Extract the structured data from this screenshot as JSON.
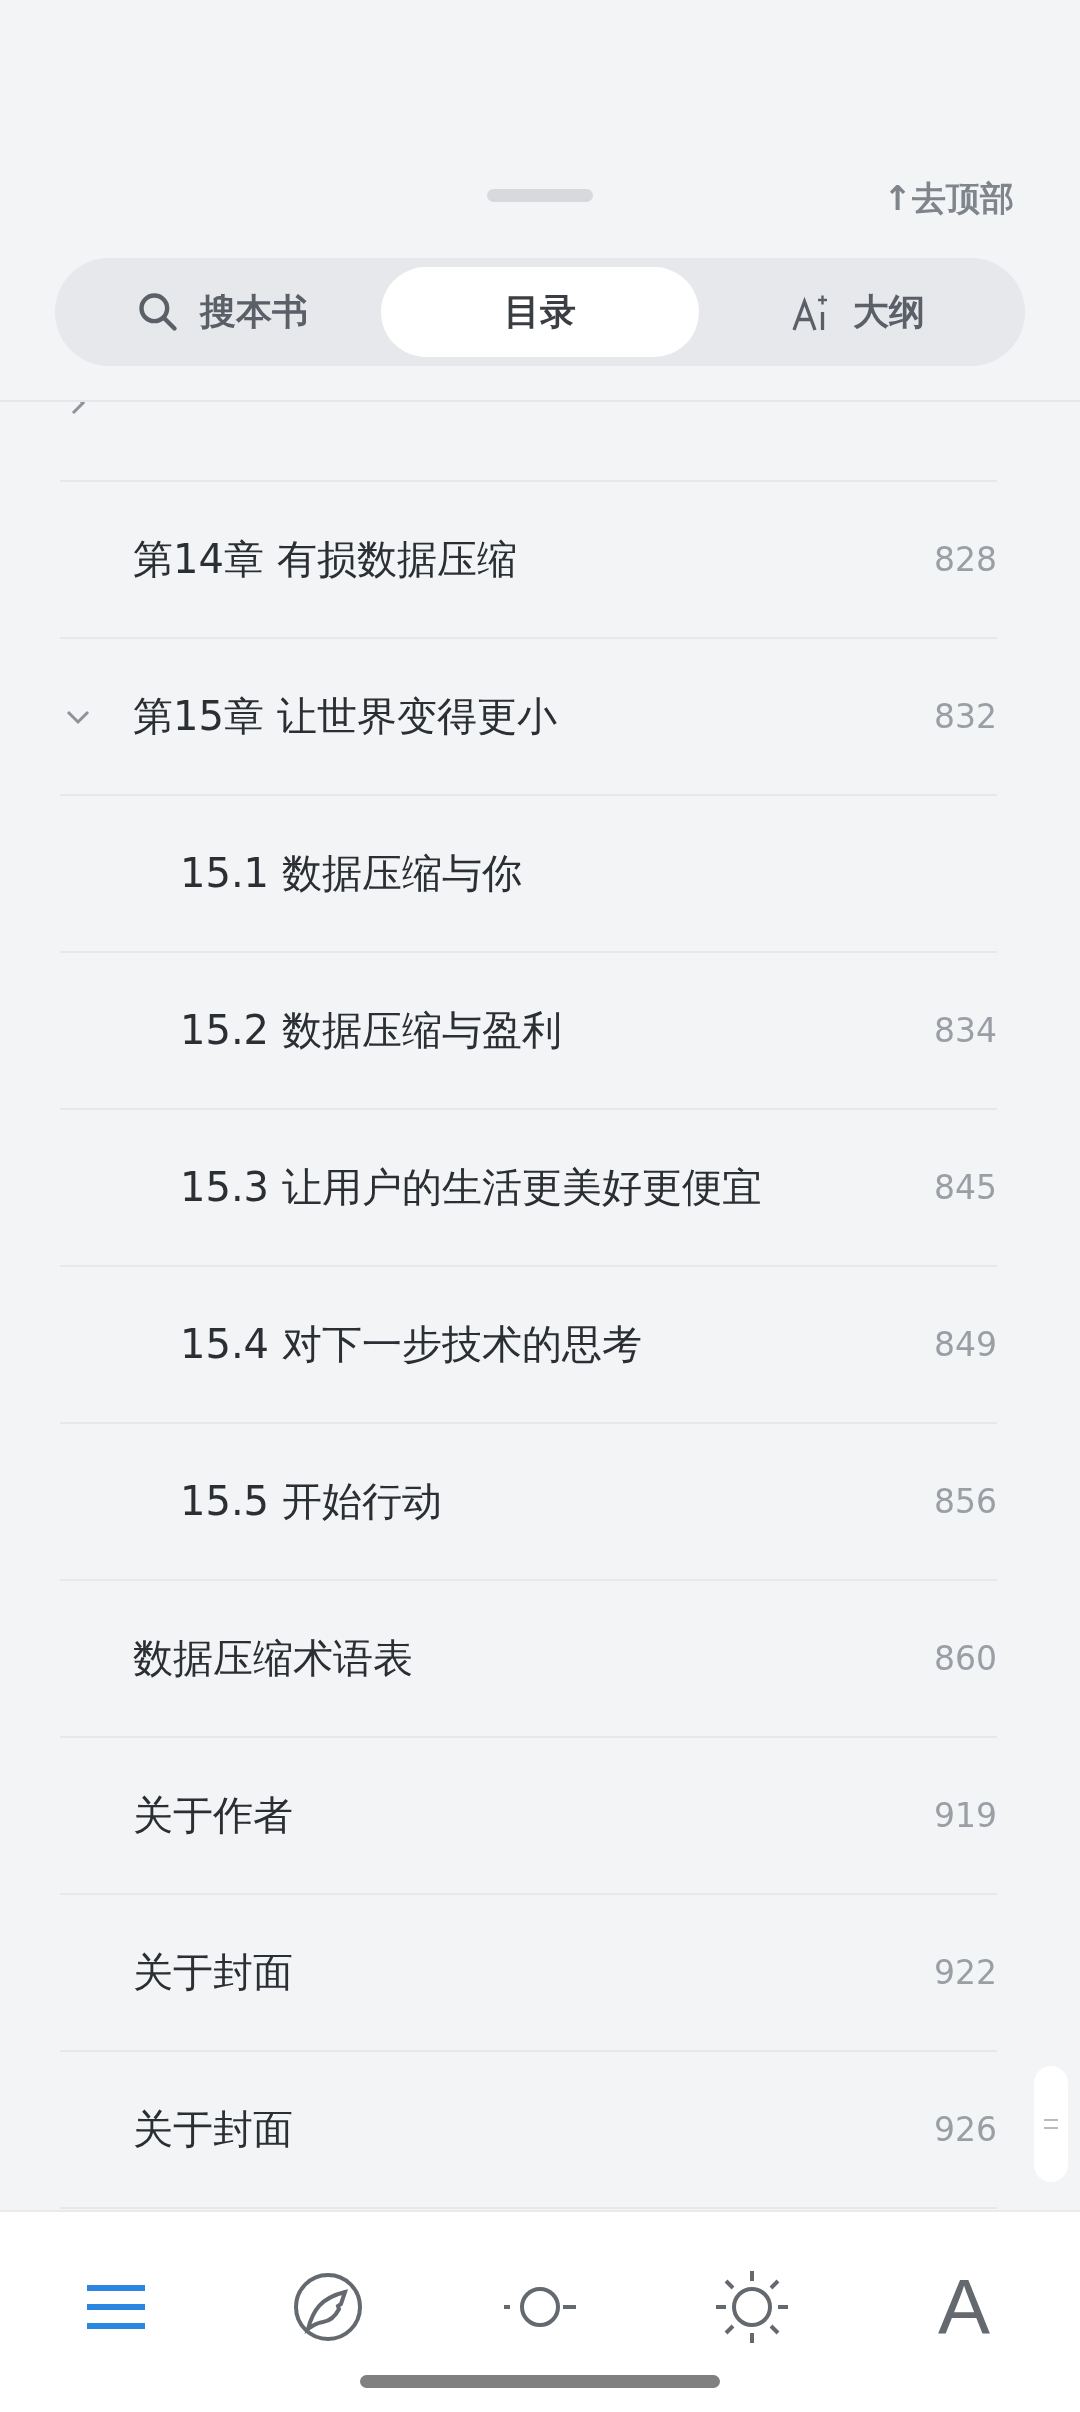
{
  "header": {
    "back_to_top": "↑去顶部"
  },
  "tabs": [
    {
      "kind": "search",
      "label": "搜本书",
      "selected": false
    },
    {
      "kind": "toc",
      "label": "目录",
      "selected": true
    },
    {
      "kind": "outline",
      "label": "大纲",
      "selected": false
    }
  ],
  "toc": [
    {
      "expanded": false
    },
    {
      "title": "第14章 有损数据压缩",
      "page": "828"
    },
    {
      "title": "第15章 让世界变得更小",
      "page": "832",
      "expanded": true,
      "children": [
        {
          "title": "15.1 数据压缩与你"
        },
        {
          "title": "15.2 数据压缩与盈利",
          "page": "834"
        },
        {
          "title": "15.3 让用户的生活更美好更便宜",
          "page": "845"
        },
        {
          "title": "15.4 对下一步技术的思考",
          "page": "849"
        },
        {
          "title": "15.5 开始行动",
          "page": "856"
        }
      ]
    },
    {
      "title": "数据压缩术语表",
      "page": "860"
    },
    {
      "title": "关于作者",
      "page": "919"
    },
    {
      "title": "关于封面",
      "page": "922"
    },
    {
      "title": "关于封面",
      "page": "926"
    }
  ],
  "bottom_bar": [
    {
      "kind": "contents",
      "selected": true
    },
    {
      "kind": "notes",
      "selected": false
    },
    {
      "kind": "brightness-low",
      "selected": false
    },
    {
      "kind": "brightness-high",
      "selected": false
    },
    {
      "kind": "font",
      "label": "A",
      "selected": false
    }
  ]
}
